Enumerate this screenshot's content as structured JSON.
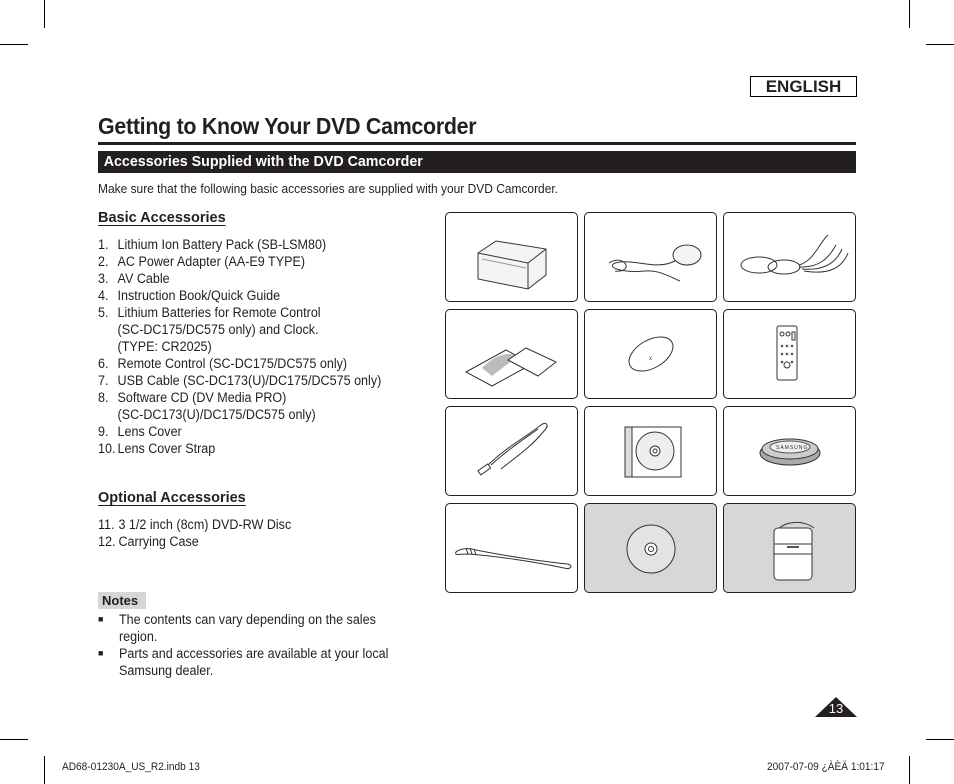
{
  "language_badge": "ENGLISH",
  "page_title": "Getting to Know Your DVD Camcorder",
  "section_title": "Accessories Supplied with the DVD Camcorder",
  "intro": "Make sure that the following basic accessories are supplied with your DVD Camcorder.",
  "basic": {
    "heading": "Basic Accessories",
    "items": [
      {
        "num": "1.",
        "lines": [
          "Lithium Ion Battery Pack (SB-LSM80)"
        ]
      },
      {
        "num": "2.",
        "lines": [
          "AC Power Adapter (AA-E9 TYPE)"
        ]
      },
      {
        "num": "3.",
        "lines": [
          "AV Cable"
        ]
      },
      {
        "num": "4.",
        "lines": [
          "Instruction Book/Quick Guide"
        ]
      },
      {
        "num": "5.",
        "lines": [
          "Lithium Batteries for Remote Control",
          "(SC-DC175/DC575 only) and Clock.",
          "(TYPE: CR2025)"
        ]
      },
      {
        "num": "6.",
        "lines": [
          "Remote Control (SC-DC175/DC575 only)"
        ]
      },
      {
        "num": "7.",
        "lines": [
          "USB Cable (SC-DC173(U)/DC175/DC575 only)"
        ]
      },
      {
        "num": "8.",
        "lines": [
          "Software CD (DV Media PRO)",
          "(SC-DC173(U)/DC175/DC575 only)"
        ]
      },
      {
        "num": "9.",
        "lines": [
          "Lens Cover"
        ]
      },
      {
        "num": "10.",
        "lines": [
          "Lens Cover Strap"
        ]
      }
    ]
  },
  "optional": {
    "heading": "Optional Accessories",
    "items": [
      {
        "num": "11.",
        "lines": [
          "3 1/2 inch (8cm) DVD-RW Disc"
        ]
      },
      {
        "num": "12.",
        "lines": [
          "Carrying Case"
        ]
      }
    ]
  },
  "notes": {
    "label": "Notes",
    "items": [
      "The contents can vary depending on the sales region.",
      "Parts and accessories are available at your local Samsung dealer."
    ]
  },
  "images": [
    {
      "icon": "battery-pack-icon",
      "optional": false
    },
    {
      "icon": "ac-adapter-icon",
      "optional": false
    },
    {
      "icon": "av-cable-icon",
      "optional": false
    },
    {
      "icon": "instruction-book-icon",
      "optional": false
    },
    {
      "icon": "lithium-battery-icon",
      "optional": false
    },
    {
      "icon": "remote-control-icon",
      "optional": false
    },
    {
      "icon": "usb-cable-icon",
      "optional": false
    },
    {
      "icon": "software-cd-icon",
      "optional": false
    },
    {
      "icon": "lens-cover-icon",
      "optional": false
    },
    {
      "icon": "lens-cover-strap-icon",
      "optional": false
    },
    {
      "icon": "dvd-rw-disc-icon",
      "optional": true
    },
    {
      "icon": "carrying-case-icon",
      "optional": true
    }
  ],
  "colors": {
    "ink": "#231f20",
    "optional_bg": "#d7d7d7",
    "notes_bg": "#d6d6d6"
  },
  "page_number": "13",
  "footer": {
    "file": "AD68-01230A_US_R2.indb   13",
    "timestamp": "2007-07-09   ¿ÀÈÄ 1:01:17"
  }
}
